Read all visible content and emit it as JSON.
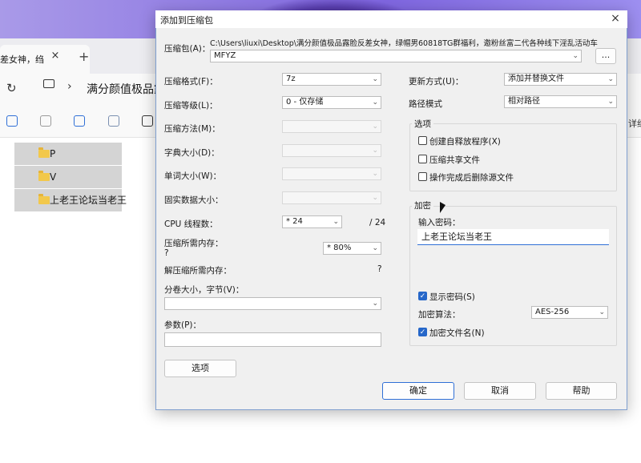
{
  "background": {
    "tab_label": "差女神，绉",
    "tab_close": "×",
    "tab_new": "+",
    "nav_refresh": "↻",
    "nav_chevron": "›",
    "path_text": "满分颜值极品露",
    "detail_label": "详细",
    "files": [
      "P",
      "V",
      "上老王论坛当老王"
    ]
  },
  "dialog": {
    "title": "添加到压缩包",
    "close": "×",
    "archive_label": "压缩包(A)：",
    "archive_path": "C:\\Users\\liuxi\\Desktop\\满分颜值极品露脸反差女神，绿帽男60818TG群福利，邀粉丝富二代各种线下淫乱活动车",
    "archive_name": "MFYZ",
    "browse_label": "...",
    "format_label": "压缩格式(F)：",
    "format_value": "7z",
    "level_label": "压缩等级(L)：",
    "level_value": "0 - 仅存储",
    "method_label": "压缩方法(M)：",
    "dict_label": "字典大小(D)：",
    "word_label": "单词大小(W)：",
    "solid_label": "固实数据大小：",
    "cpu_label": "CPU 线程数：",
    "cpu_value": "* 24",
    "cpu_total": "/ 24",
    "mem_label": "压缩所需内存：",
    "mem_value_label": "?",
    "mem_pct": "* 80%",
    "decomp_label": "解压缩所需内存：",
    "decomp_value": "?",
    "volume_label": "分卷大小，字节(V)：",
    "params_label": "参数(P)：",
    "options_button": "选项",
    "update_label": "更新方式(U)：",
    "update_value": "添加并替换文件",
    "pathmode_label": "路径模式",
    "pathmode_value": "相对路径",
    "options_group": "选项",
    "opt_sfx": "创建自释放程序(X)",
    "opt_shared": "压缩共享文件",
    "opt_delete": "操作完成后删除源文件",
    "encrypt_group": "加密",
    "pwd_label": "输入密码：",
    "pwd_value": "上老王论坛当老王",
    "show_pwd": "显示密码(S)",
    "enc_method_label": "加密算法：",
    "enc_method_value": "AES-256",
    "enc_names": "加密文件名(N)",
    "ok": "确定",
    "cancel": "取消",
    "help": "帮助",
    "dropdown_arrow": "⌄",
    "check_mark": "✓"
  }
}
